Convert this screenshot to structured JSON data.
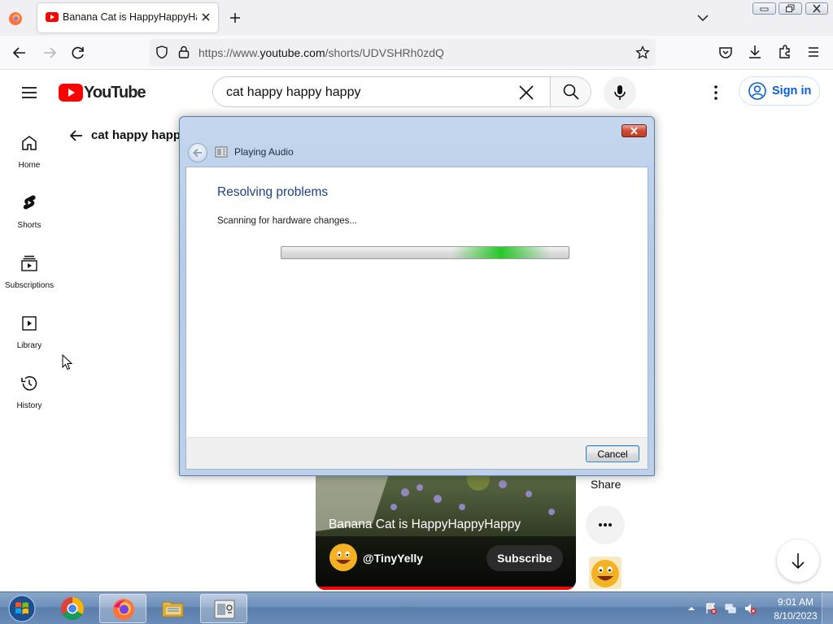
{
  "browser": {
    "tab": {
      "title": "Banana Cat is HappyHappyHappy",
      "favicon": "youtube-favicon"
    },
    "address_bar": {
      "url_prefix": "https://www.",
      "url_domain": "youtube.com",
      "url_path": "/shorts/UDVSHRh0zdQ"
    }
  },
  "youtube": {
    "logo_text": "YouTube",
    "search": {
      "query": "cat happy happy happy"
    },
    "sign_in_label": "Sign in",
    "sidebar": [
      {
        "label": "Home",
        "icon": "home-icon"
      },
      {
        "label": "Shorts",
        "icon": "shorts-icon"
      },
      {
        "label": "Subscriptions",
        "icon": "subscriptions-icon"
      },
      {
        "label": "Library",
        "icon": "library-icon"
      },
      {
        "label": "History",
        "icon": "history-icon"
      }
    ],
    "back_title": "cat happy happy happy",
    "short": {
      "title": "Banana Cat is HappyHappyHappy",
      "channel": "@TinyYelly",
      "subscribe_label": "Subscribe"
    },
    "share_label": "Share"
  },
  "dialog": {
    "caption": "Playing Audio",
    "heading": "Resolving problems",
    "status": "Scanning for hardware changes...",
    "cancel_label": "Cancel"
  },
  "taskbar": {
    "apps": [
      "chrome-icon",
      "firefox-icon",
      "file-explorer-icon",
      "troubleshooter-icon"
    ],
    "clock": {
      "time": "9:01 AM",
      "date": "8/10/2023"
    }
  },
  "colors": {
    "youtube_red": "#ff0000",
    "link_blue": "#065fd4",
    "dialog_heading": "#1e3f8a"
  }
}
